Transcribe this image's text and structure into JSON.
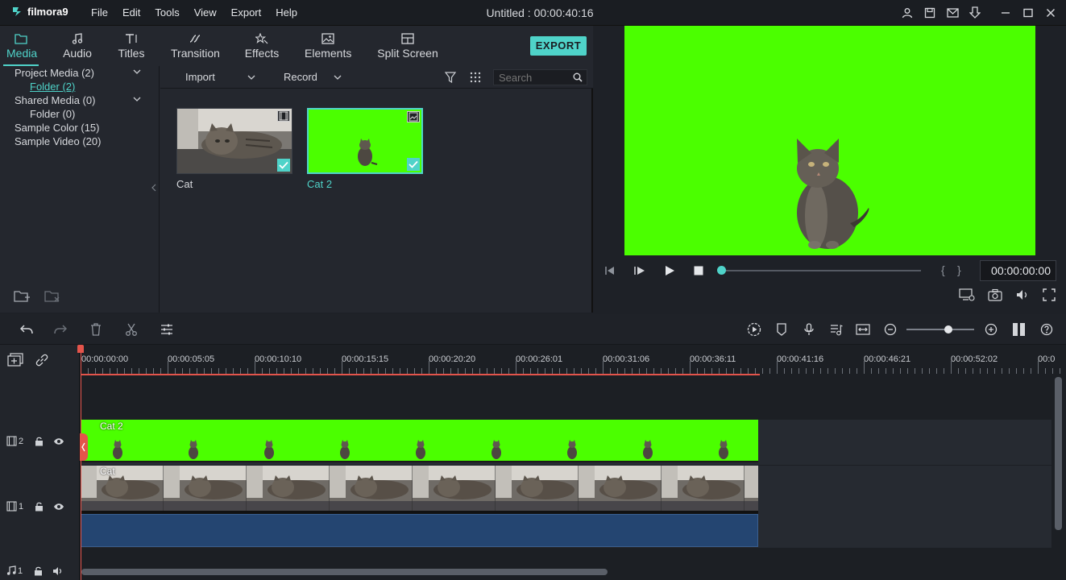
{
  "app": {
    "name": "filmora9",
    "window_title": "Untitled : 00:00:40:16"
  },
  "menu": [
    "File",
    "Edit",
    "Tools",
    "View",
    "Export",
    "Help"
  ],
  "tabs": [
    {
      "label": "Media",
      "icon": "folder-icon",
      "active": true
    },
    {
      "label": "Audio",
      "icon": "music-note-icon",
      "active": false
    },
    {
      "label": "Titles",
      "icon": "titles-icon",
      "active": false
    },
    {
      "label": "Transition",
      "icon": "transition-icon",
      "active": false
    },
    {
      "label": "Effects",
      "icon": "effects-icon",
      "active": false
    },
    {
      "label": "Elements",
      "icon": "image-icon",
      "active": false
    },
    {
      "label": "Split Screen",
      "icon": "split-screen-icon",
      "active": false
    }
  ],
  "export_label": "EXPORT",
  "folders": [
    {
      "label": "Project Media (2)",
      "expandable": true
    },
    {
      "label": "Folder (2)",
      "selected": true
    },
    {
      "label": "Shared Media (0)",
      "expandable": true
    },
    {
      "label": "Folder (0)"
    },
    {
      "label": "Sample Color (15)"
    },
    {
      "label": "Sample Video (20)"
    }
  ],
  "media_toolbar": {
    "import_label": "Import",
    "record_label": "Record",
    "search_placeholder": "Search"
  },
  "media_items": [
    {
      "label": "Cat",
      "type": "video",
      "selected": false
    },
    {
      "label": "Cat 2",
      "type": "image",
      "selected": true
    }
  ],
  "preview": {
    "timecode": "00:00:00:00",
    "background_color": "#4bff00"
  },
  "ruler_ticks": [
    "00:00:00:00",
    "00:00:05:05",
    "00:00:10:10",
    "00:00:15:15",
    "00:00:20:20",
    "00:00:26:01",
    "00:00:31:06",
    "00:00:36:11",
    "00:00:41:16",
    "00:00:46:21",
    "00:00:52:02",
    "00:0"
  ],
  "tracks": [
    {
      "number": "2",
      "clip_label": "Cat 2"
    },
    {
      "number": "1",
      "clip_label": "Cat"
    },
    {
      "number": "1",
      "type": "audio"
    }
  ],
  "colors": {
    "accent": "#4fd3c9",
    "playhead": "#e4544b",
    "green_screen": "#4bff00"
  }
}
